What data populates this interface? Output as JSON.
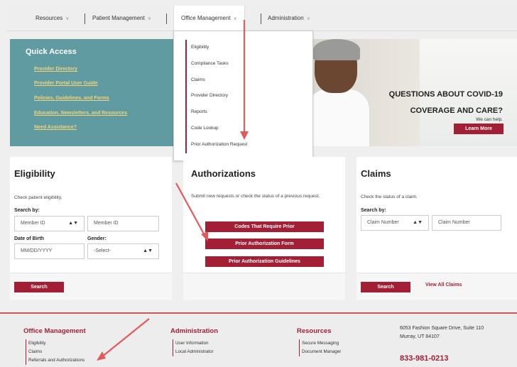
{
  "nav": {
    "items": [
      "Resources",
      "Patient Management",
      "Office Management",
      "Administration"
    ],
    "chevron": "∨"
  },
  "dropdown": {
    "items": [
      "Eligibility",
      "Compliance Tasks",
      "Claims",
      "Provider Directory",
      "Reports",
      "Code Lookup",
      "Prior Authorization Request"
    ]
  },
  "quick_access": {
    "title": "Quick Access",
    "links": [
      "Provider Directory",
      "Provider Portal User Guide",
      "Policies, Guidelines, and Forms",
      "Education, Newsletters, and Resources",
      "Need Assistance?"
    ]
  },
  "hero": {
    "line1": "QUESTIONS ABOUT COVID-19",
    "line2": "COVERAGE AND CARE?",
    "line3": "We can help.",
    "cta": "Learn More"
  },
  "eligibility": {
    "title": "Eligibility",
    "desc": "Check patient eligibility.",
    "search_by_label": "Search by:",
    "search_by_value": "Member ID",
    "member_id_placeholder": "Member ID",
    "dob_label": "Date of Birth",
    "dob_placeholder": "MM/DD/YYYY",
    "gender_label": "Gender:",
    "gender_value": "-Select-",
    "search_button": "Search"
  },
  "authorizations": {
    "title": "Authorizations",
    "desc": "Submit new requests or check the status of a previous request.",
    "buttons": [
      "Codes That Require Prior",
      "Prior Authorization Form",
      "Prior Authorization Guidelines"
    ]
  },
  "claims": {
    "title": "Claims",
    "desc": "Check the status of a claim.",
    "search_by_label": "Search by:",
    "search_by_value": "Claim Number",
    "claim_placeholder": "Claim Number",
    "search_button": "Search",
    "view_all": "View All Claims"
  },
  "footer": {
    "office": {
      "title": "Office Management",
      "links": [
        "Eligibility",
        "Claims",
        "Referrals and Authorizations"
      ]
    },
    "admin": {
      "title": "Administration",
      "links": [
        "User Information",
        "Local Administrator"
      ]
    },
    "resources": {
      "title": "Resources",
      "links": [
        "Secure Messaging",
        "Document Manager"
      ]
    },
    "address_line1": "6053 Fashion Square Drive, Suite 110",
    "address_line2": "Murray, UT 84107",
    "phone": "833-981-0213"
  },
  "colors": {
    "brand": "#a31f35",
    "teal": "#5f9ba0",
    "link_gold": "#f3d27a"
  }
}
